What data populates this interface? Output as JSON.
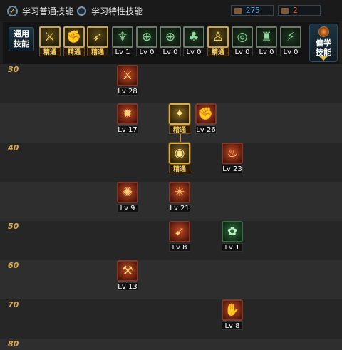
{
  "tabs": {
    "normal_label": "学习普通技能",
    "special_label": "学习特性技能"
  },
  "points": {
    "sp_value": "275",
    "tp_value": "2",
    "sp_color": "#4aa7e6",
    "tp_color": "#f06a3a"
  },
  "category": {
    "left_label_line1": "通用",
    "left_label_line2": "技能",
    "right_label_line1": "偏学",
    "right_label_line2": "技能"
  },
  "passives": [
    {
      "icon": "spear-warrior-icon",
      "glyph": "⚔",
      "style": "gold",
      "label": "精通"
    },
    {
      "icon": "crouch-warrior-icon",
      "glyph": "✊",
      "style": "gold",
      "label": "精通"
    },
    {
      "icon": "dash-warrior-icon",
      "glyph": "➶",
      "style": "gold",
      "label": "精通"
    },
    {
      "icon": "wings-emblem-icon",
      "glyph": "♆",
      "style": "green",
      "label": "Lv 1"
    },
    {
      "icon": "crosshair-icon",
      "glyph": "⊕",
      "style": "green",
      "label": "Lv 0"
    },
    {
      "icon": "crosshair-gold-icon",
      "glyph": "⊕",
      "style": "green",
      "label": "Lv 0"
    },
    {
      "icon": "crawl-figure-icon",
      "glyph": "♣",
      "style": "green",
      "label": "Lv 0"
    },
    {
      "icon": "yellow-figure-icon",
      "glyph": "♙",
      "style": "gold",
      "label": "精通"
    },
    {
      "icon": "spiral-eye-icon",
      "glyph": "◎",
      "style": "green",
      "label": "Lv 0"
    },
    {
      "icon": "armor-figure-icon",
      "glyph": "♜",
      "style": "green",
      "label": "Lv 0"
    },
    {
      "icon": "kick-figure-icon",
      "glyph": "⚡",
      "style": "green",
      "label": "Lv 0"
    }
  ],
  "levels": [
    "30",
    "40",
    "50",
    "60",
    "70",
    "80"
  ],
  "skills": [
    {
      "name": "skill-flame-strike",
      "icon": "flame-strike-icon",
      "glyph": "⚔",
      "style": "red",
      "label": "Lv 28"
    },
    {
      "name": "skill-fire-burst",
      "icon": "fire-burst-icon",
      "glyph": "✹",
      "style": "red",
      "label": "Lv 17"
    },
    {
      "name": "skill-golden-beast",
      "icon": "golden-beast-icon",
      "glyph": "✦",
      "style": "goldsel",
      "label": "精通"
    },
    {
      "name": "skill-flame-fist",
      "icon": "flame-fist-icon",
      "glyph": "✊",
      "style": "red",
      "label": "Lv 26"
    },
    {
      "name": "skill-golden-orb",
      "icon": "golden-orb-icon",
      "glyph": "◉",
      "style": "goldsel",
      "label": "精通"
    },
    {
      "name": "skill-fire-dragon",
      "icon": "fire-dragon-icon",
      "glyph": "♨",
      "style": "red",
      "label": "Lv 23"
    },
    {
      "name": "skill-green-rune",
      "icon": "green-rune-icon",
      "glyph": "✺",
      "style": "red",
      "label": "Lv 9"
    },
    {
      "name": "skill-star-blast",
      "icon": "star-blast-icon",
      "glyph": "✳",
      "style": "red",
      "label": "Lv 21"
    },
    {
      "name": "skill-kick-flame",
      "icon": "kick-flame-icon",
      "glyph": "➹",
      "style": "red",
      "label": "Lv 8"
    },
    {
      "name": "skill-green-vortex",
      "icon": "green-vortex-icon",
      "glyph": "✿",
      "style": "green",
      "label": "Lv 1"
    },
    {
      "name": "skill-blaze-axe",
      "icon": "blaze-axe-icon",
      "glyph": "⚒",
      "style": "red",
      "label": "Lv 13"
    },
    {
      "name": "skill-fire-grip",
      "icon": "fire-grip-icon",
      "glyph": "✋",
      "style": "red",
      "label": "Lv 8"
    }
  ]
}
